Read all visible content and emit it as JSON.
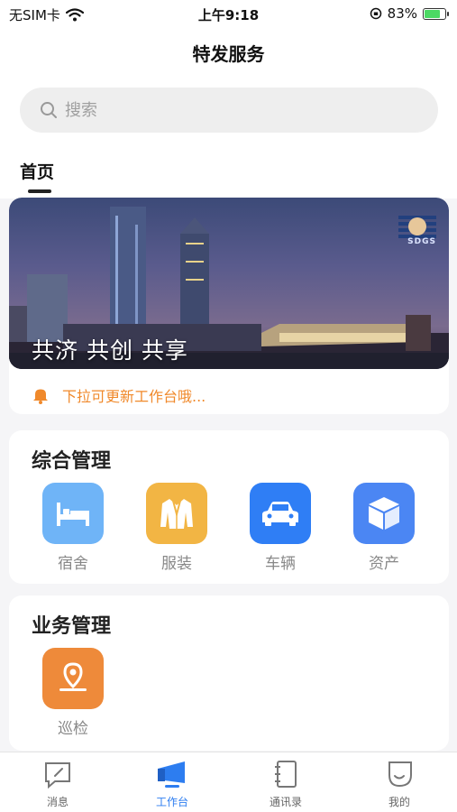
{
  "status_bar": {
    "carrier": "无SIM卡",
    "time": "上午9:18",
    "battery": "83%",
    "battery_level": 0.83
  },
  "header": {
    "title": "特发服务"
  },
  "search": {
    "placeholder": "搜索"
  },
  "tabs": {
    "home": "首页"
  },
  "banner": {
    "slogan": "共济  共创  共享",
    "logo_text": "SDGS"
  },
  "notice": {
    "text": "下拉可更新工作台哦..."
  },
  "sections": {
    "general": {
      "title": "综合管理",
      "items": [
        {
          "label": "宿舍",
          "icon": "bed-icon",
          "color": "#6fb4f7"
        },
        {
          "label": "服装",
          "icon": "suit-icon",
          "color": "#f2b544"
        },
        {
          "label": "车辆",
          "icon": "car-icon",
          "color": "#2f7ef5"
        },
        {
          "label": "资产",
          "icon": "box-icon",
          "color": "#4b86f3"
        }
      ]
    },
    "business": {
      "title": "业务管理",
      "items": [
        {
          "label": "巡检",
          "icon": "location-pin-icon",
          "color": "#ee8a3a"
        }
      ]
    }
  },
  "tabbar": {
    "items": [
      {
        "label": "消息",
        "icon": "message-icon"
      },
      {
        "label": "工作台",
        "icon": "workbench-icon",
        "active": true
      },
      {
        "label": "通讯录",
        "icon": "contacts-icon"
      },
      {
        "label": "我的",
        "icon": "profile-icon"
      }
    ],
    "active_color": "#2d7df0"
  }
}
